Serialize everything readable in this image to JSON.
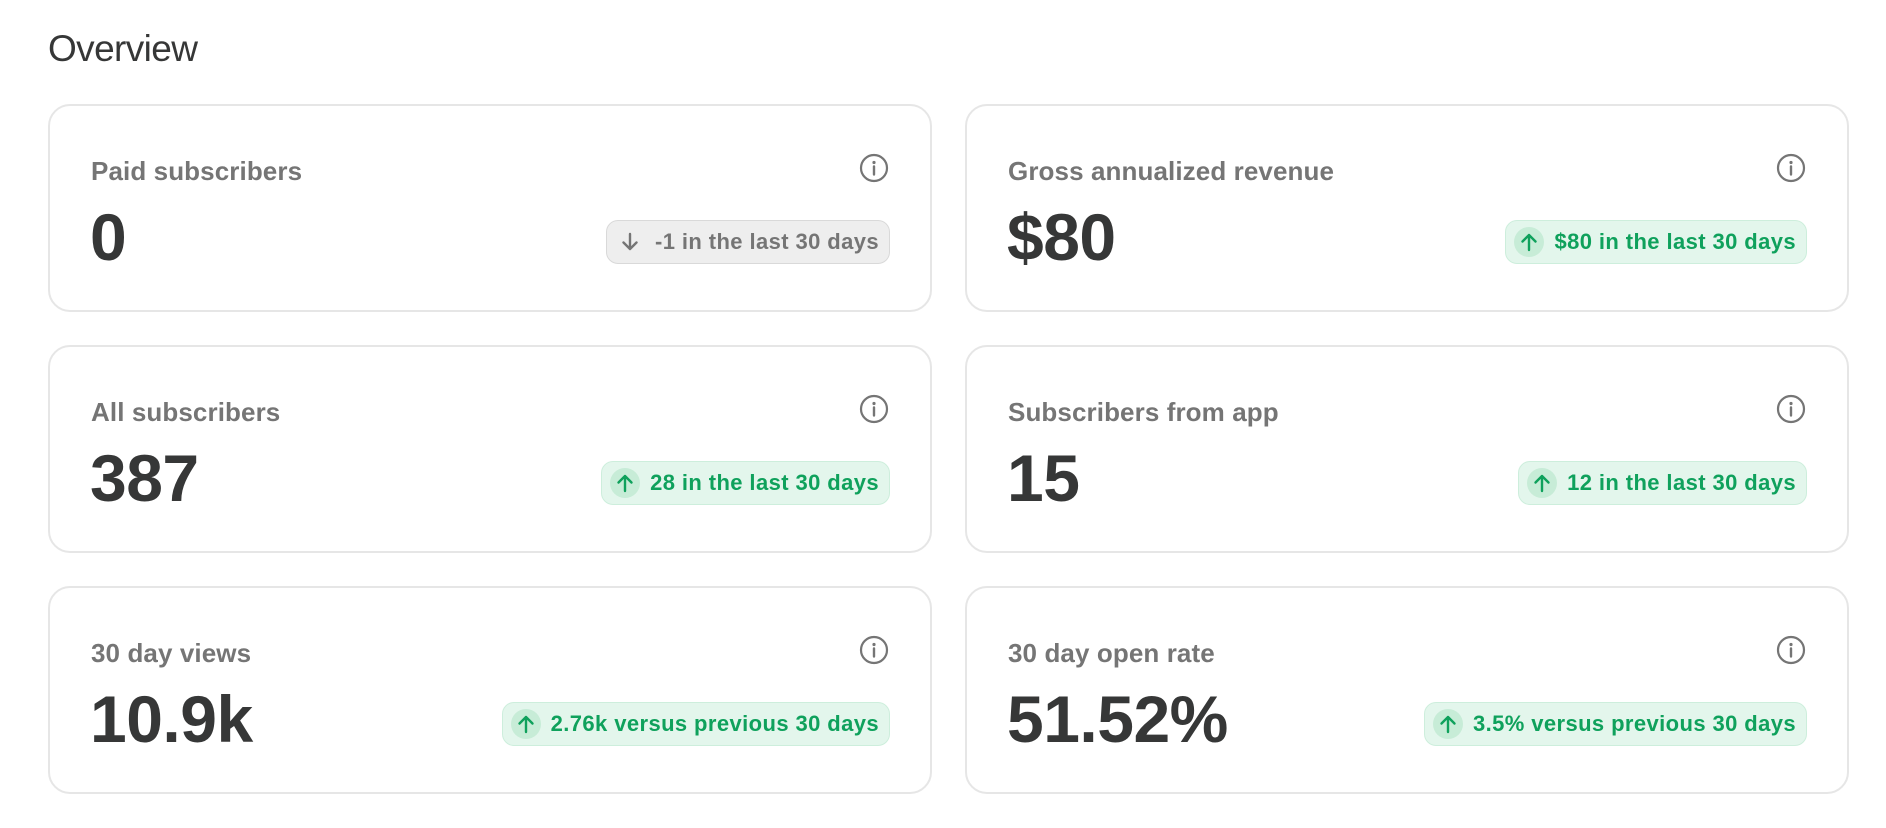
{
  "page": {
    "title": "Overview"
  },
  "cards": [
    {
      "label": "Paid subscribers",
      "value": "0",
      "change": "-1 in the last 30 days",
      "trend": "down"
    },
    {
      "label": "Gross annualized revenue",
      "value": "$80",
      "change": "$80 in the last 30 days",
      "trend": "up"
    },
    {
      "label": "All subscribers",
      "value": "387",
      "change": "28 in the last 30 days",
      "trend": "up"
    },
    {
      "label": "Subscribers from app",
      "value": "15",
      "change": "12 in the last 30 days",
      "trend": "up"
    },
    {
      "label": "30 day views",
      "value": "10.9k",
      "change": "2.76k versus previous 30 days",
      "trend": "up"
    },
    {
      "label": "30 day open rate",
      "value": "51.52%",
      "change": "3.5% versus previous 30 days",
      "trend": "up"
    }
  ],
  "icons": {
    "info": "info-circle-icon",
    "up": "arrow-up-icon",
    "down": "arrow-down-icon"
  },
  "colors": {
    "up_text": "#0fa15c",
    "up_bg": "#e3f6ec",
    "down_text": "#757575",
    "down_bg": "#eeeeee"
  }
}
